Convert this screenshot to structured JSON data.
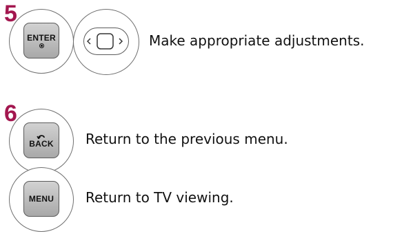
{
  "steps": [
    {
      "number": "5",
      "buttons": [
        "ENTER",
        "navigation-pad"
      ],
      "text": "Make appropriate adjustments."
    },
    {
      "number": "6",
      "buttons": [
        "BACK"
      ],
      "text": "Return to the previous menu."
    },
    {
      "buttons": [
        "MENU"
      ],
      "text": "Return to TV viewing."
    }
  ],
  "labels": {
    "enter": "ENTER",
    "back": "BACK",
    "menu": "MENU"
  },
  "colors": {
    "step_number": "#a3174f",
    "button_fill": "#bcbcbc",
    "ring_border": "#6f6f6f"
  },
  "icons": {
    "enter_dot": "circle-dot-icon",
    "back_arrow": "back-arrow-icon",
    "nav_left": "chevron-left-icon",
    "nav_right": "chevron-right-icon",
    "nav_center": "square-icon"
  }
}
